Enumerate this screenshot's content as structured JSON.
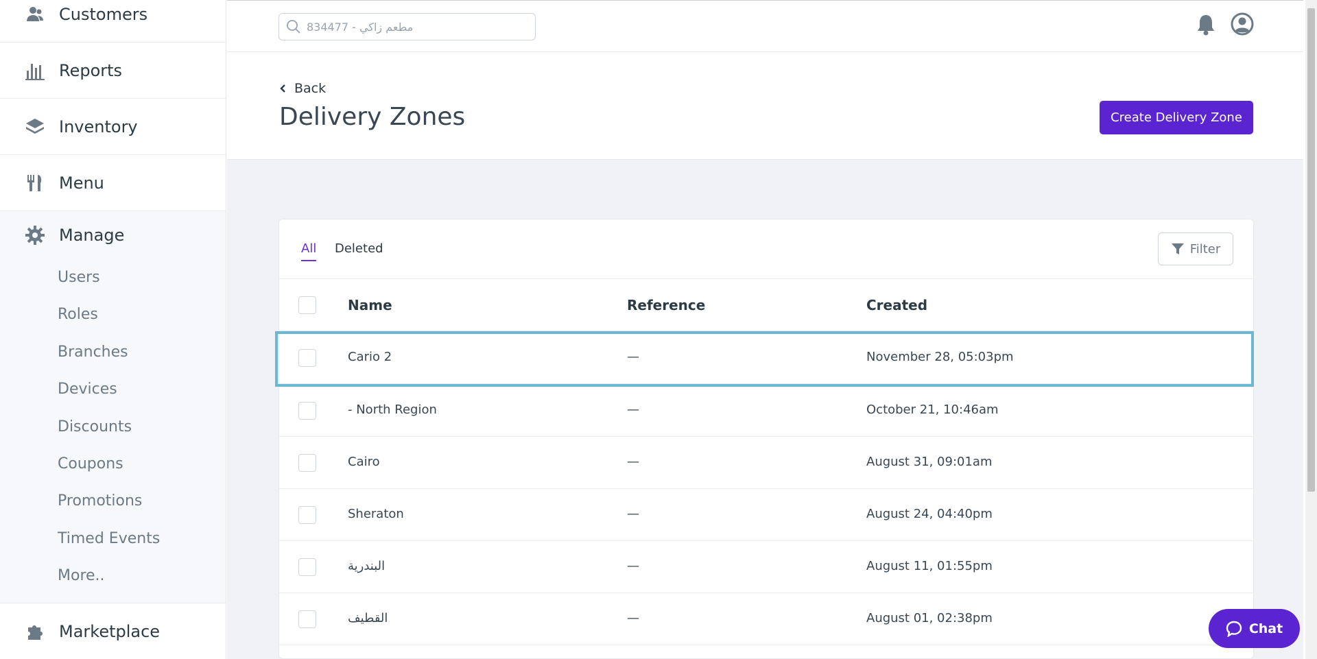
{
  "sidebar": {
    "items": [
      {
        "label": "Customers",
        "icon": "customers-icon"
      },
      {
        "label": "Reports",
        "icon": "reports-icon"
      },
      {
        "label": "Inventory",
        "icon": "inventory-icon"
      },
      {
        "label": "Menu",
        "icon": "menu-icon"
      }
    ],
    "manage": {
      "label": "Manage",
      "icon": "gear-icon",
      "sub_items": [
        "Users",
        "Roles",
        "Branches",
        "Devices",
        "Discounts",
        "Coupons",
        "Promotions",
        "Timed Events",
        "More.."
      ]
    },
    "marketplace": {
      "label": "Marketplace",
      "icon": "puzzle-icon"
    }
  },
  "topbar": {
    "search_placeholder": "مطعم زاكي - 834477"
  },
  "header": {
    "back_label": "Back",
    "title": "Delivery Zones",
    "create_label": "Create Delivery Zone"
  },
  "tabs": [
    {
      "label": "All",
      "active": true
    },
    {
      "label": "Deleted",
      "active": false
    }
  ],
  "filter_label": "Filter",
  "table": {
    "columns": [
      "Name",
      "Reference",
      "Created"
    ],
    "rows": [
      {
        "name": "Cario 2",
        "reference": "—",
        "created": "November 28, 05:03pm"
      },
      {
        "name": "- North Region",
        "reference": "—",
        "created": "October 21, 10:46am"
      },
      {
        "name": "Cairo",
        "reference": "—",
        "created": "August 31, 09:01am"
      },
      {
        "name": "Sheraton",
        "reference": "—",
        "created": "August 24, 04:40pm"
      },
      {
        "name": "البندرية",
        "reference": "—",
        "created": "August 11, 01:55pm"
      },
      {
        "name": "القطيف",
        "reference": "—",
        "created": "August 01, 02:38pm"
      }
    ]
  },
  "chat_label": "Chat",
  "colors": {
    "accent": "#5a24d1",
    "highlight": "#6cb8d4"
  }
}
